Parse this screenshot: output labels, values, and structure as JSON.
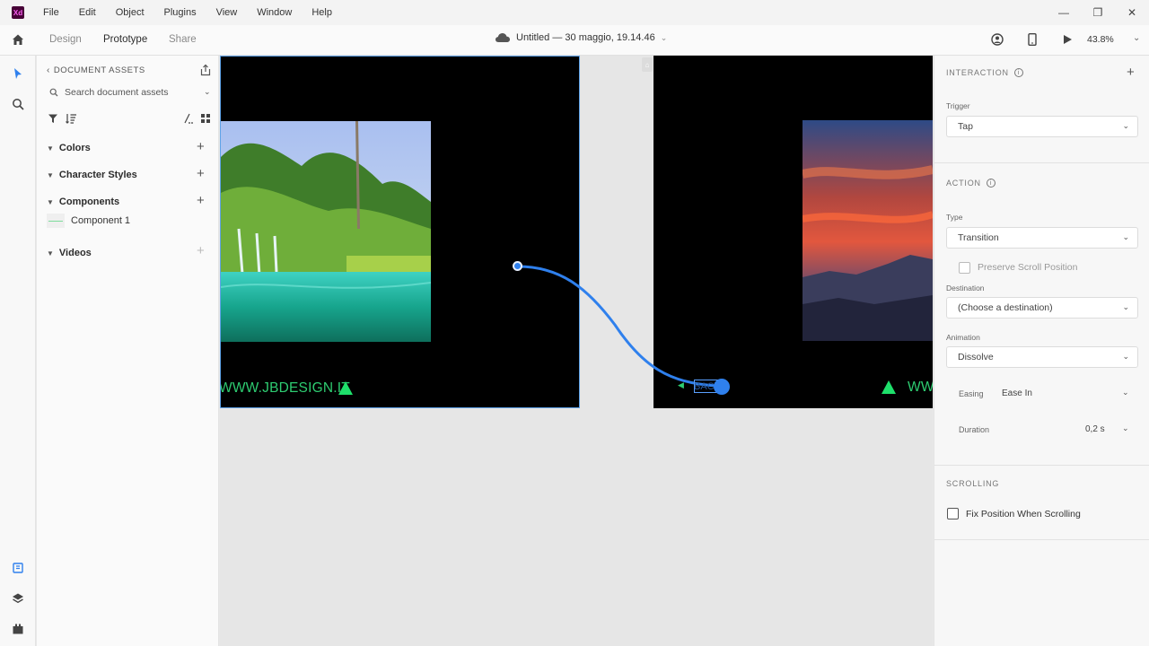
{
  "app": {
    "logo_text": "Xd"
  },
  "menu": {
    "items": [
      "File",
      "Edit",
      "Object",
      "Plugins",
      "View",
      "Window",
      "Help"
    ]
  },
  "window_controls": {
    "minimize": "—",
    "restore": "❐",
    "close": "✕"
  },
  "topbar": {
    "modes": [
      "Design",
      "Prototype",
      "Share"
    ],
    "active_mode": "Prototype",
    "doc_title": "Untitled — 30 maggio, 19.14.46",
    "zoom": "43.8%"
  },
  "assets": {
    "header": "DOCUMENT ASSETS",
    "search_placeholder": "Search document assets",
    "sections": {
      "colors": "Colors",
      "character_styles": "Character Styles",
      "components": "Components",
      "videos": "Videos"
    },
    "component_item": "Component 1"
  },
  "canvas": {
    "artboard1_site": "WWW.JBDESIGN.IT",
    "artboard2_site": "WW",
    "back_button": "BACK"
  },
  "inspector": {
    "interaction_title": "INTERACTION",
    "trigger_label": "Trigger",
    "trigger_value": "Tap",
    "action_title": "ACTION",
    "type_label": "Type",
    "type_value": "Transition",
    "preserve_scroll": "Preserve Scroll Position",
    "destination_label": "Destination",
    "destination_value": "(Choose a destination)",
    "animation_label": "Animation",
    "animation_value": "Dissolve",
    "easing_label": "Easing",
    "easing_value": "Ease In",
    "duration_label": "Duration",
    "duration_value": "0,2 s",
    "scrolling_title": "SCROLLING",
    "fix_position": "Fix Position When Scrolling"
  },
  "colors": {
    "accent": "#2f80ed",
    "site_green": "#2ecc71",
    "artboard_bg": "#000000"
  }
}
